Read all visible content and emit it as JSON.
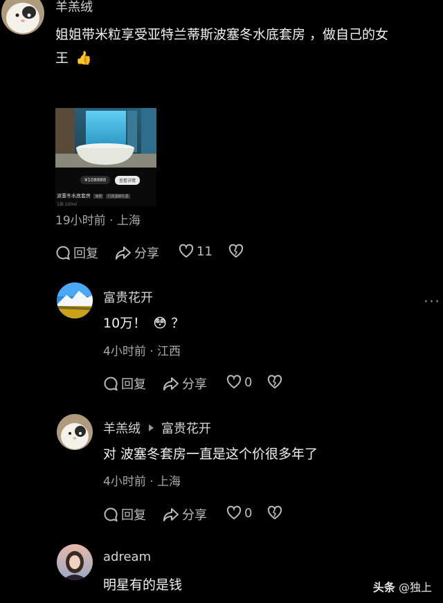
{
  "comments": [
    {
      "user": "羊羔绒",
      "text_line1": "姐姐带米粒享受亚特兰蒂斯波塞冬水底套房 ，做自己的女",
      "text_line2": "王",
      "emoji": "👍",
      "card": {
        "price": "¥108888",
        "button": "查看详情",
        "title": "波塞冬水底套房",
        "tags": [
          "海景",
          "行政酒廊礼遇"
        ],
        "subline": "1张   100㎡"
      },
      "meta": "19小时前 · 上海",
      "reply_label": "回复",
      "share_label": "分享",
      "like_count": "11"
    },
    {
      "user": "富贵花开",
      "text": "10万！",
      "emoji": "😳",
      "text_suffix": "？",
      "meta": "4小时前 · 江西",
      "reply_label": "回复",
      "share_label": "分享",
      "like_count": "0",
      "more": "···"
    },
    {
      "user": "羊羔绒",
      "reply_to": "富贵花开",
      "text": "对 波塞冬套房一直是这个价很多年了",
      "meta": "4小时前 · 上海",
      "reply_label": "回复",
      "share_label": "分享",
      "like_count": "0"
    },
    {
      "user": "adream",
      "text": "明星有的是钱"
    }
  ],
  "watermark": {
    "brand": "头条",
    "handle": "@独上"
  },
  "icons": {
    "reply": "comment-bubble-icon",
    "share": "share-arrow-icon",
    "like": "heart-icon",
    "dislike": "broken-heart-icon",
    "reply_arrow": "triangle-right-icon"
  }
}
